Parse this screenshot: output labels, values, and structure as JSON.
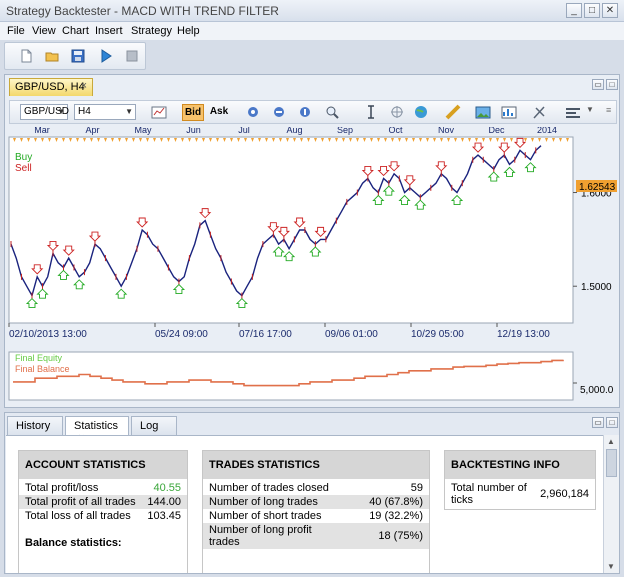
{
  "window": {
    "title": "Strategy Backtester - MACD WITH TREND FILTER"
  },
  "menu": [
    "File",
    "View",
    "Chart",
    "Insert",
    "Strategy",
    "Help"
  ],
  "toolbar": {
    "icons": [
      "new-file-icon",
      "open-folder-icon",
      "save-icon",
      "play-icon",
      "stop-icon"
    ]
  },
  "chart_tab": {
    "label": "GBP/USD, H4",
    "close": "×"
  },
  "chart_toolbar": {
    "symbol": "GBP/USD",
    "timeframe": "H4",
    "bid_label": "Bid",
    "ask_label": "Ask"
  },
  "colors": {
    "accent": "#f0a030",
    "buy": "#22aa22",
    "sell": "#cc2222",
    "equity": "#66cc44",
    "balance": "#e0704a",
    "bid_active": "#f7c26b"
  },
  "chart_data": {
    "type": "line",
    "title": "",
    "months": [
      "Mar",
      "Apr",
      "May",
      "Jun",
      "Jul",
      "Aug",
      "Sep",
      "Oct",
      "Nov",
      "Dec",
      "2014"
    ],
    "date_labels": [
      "02/10/2013 13:00",
      "05/24 09:00",
      "07/16 17:00",
      "09/06 01:00",
      "10/29 05:00",
      "12/19 13:00"
    ],
    "legend": [
      "Buy",
      "Sell"
    ],
    "y_ticks": [
      "1.6000",
      "1.5000"
    ],
    "last_price": "1.62543",
    "ylim": [
      1.465,
      1.655
    ],
    "series": [
      {
        "name": "Price",
        "values": [
          1.545,
          1.53,
          1.51,
          1.5,
          1.49,
          1.51,
          1.5,
          1.51,
          1.535,
          1.525,
          1.52,
          1.53,
          1.52,
          1.51,
          1.515,
          1.525,
          1.545,
          1.54,
          1.53,
          1.52,
          1.51,
          1.5,
          1.51,
          1.525,
          1.54,
          1.56,
          1.555,
          1.545,
          1.54,
          1.53,
          1.52,
          1.51,
          1.505,
          1.51,
          1.53,
          1.545,
          1.565,
          1.57,
          1.555,
          1.54,
          1.53,
          1.515,
          1.505,
          1.495,
          1.49,
          1.5,
          1.51,
          1.53,
          1.545,
          1.55,
          1.555,
          1.545,
          1.55,
          1.54,
          1.55,
          1.56,
          1.56,
          1.55,
          1.545,
          1.55,
          1.55,
          1.56,
          1.57,
          1.58,
          1.59,
          1.595,
          1.6,
          1.61,
          1.615,
          1.605,
          1.6,
          1.615,
          1.61,
          1.62,
          1.615,
          1.6,
          1.605,
          1.6,
          1.595,
          1.6,
          1.605,
          1.61,
          1.62,
          1.615,
          1.605,
          1.6,
          1.61,
          1.62,
          1.635,
          1.64,
          1.635,
          1.63,
          1.625,
          1.635,
          1.64,
          1.63,
          1.635,
          1.645,
          1.64,
          1.635,
          1.645,
          1.65
        ]
      }
    ],
    "lower_legend": [
      "Final Equity",
      "Final Balance"
    ],
    "lower_tick": "5,000.0",
    "lower_series": [
      {
        "name": "Final Balance",
        "values": [
          0.3,
          0.3,
          0.4,
          0.4,
          0.45,
          0.45,
          0.5,
          0.45,
          0.4,
          0.35,
          0.3,
          0.3,
          0.25,
          0.25,
          0.3,
          0.3,
          0.35,
          0.35,
          0.3,
          0.3,
          0.25,
          0.2,
          0.2,
          0.2,
          0.2,
          0.2,
          0.25,
          0.3,
          0.3,
          0.35,
          0.35,
          0.4,
          0.45,
          0.45,
          0.5,
          0.55,
          0.6,
          0.6,
          0.65,
          0.65,
          0.7,
          0.72,
          0.72,
          0.75,
          0.78,
          0.8,
          0.82,
          0.82,
          0.85,
          0.88,
          0.9
        ]
      }
    ]
  },
  "bottom_tabs": [
    {
      "label": "History"
    },
    {
      "label": "Statistics",
      "close": "×"
    },
    {
      "label": "Log"
    }
  ],
  "account_stats": {
    "header": "ACCOUNT STATISTICS",
    "rows": [
      {
        "label": "Total profit/loss",
        "value": "40.55"
      },
      {
        "label": "Total profit of all trades",
        "value": "144.00"
      },
      {
        "label": "Total loss of all trades",
        "value": "103.45"
      }
    ],
    "balance_label": "Balance statistics:"
  },
  "trades_stats": {
    "header": "TRADES STATISTICS",
    "rows": [
      {
        "label": "Number of trades closed",
        "value": "59"
      },
      {
        "label": "Number of long trades",
        "value": "40 (67.8%)"
      },
      {
        "label": "Number of short trades",
        "value": "19 (32.2%)"
      },
      {
        "label": "Number of long profit trades",
        "value": "18 (75%)"
      }
    ]
  },
  "backtesting_info": {
    "header": "BACKTESTING INFO",
    "rows": [
      {
        "label": "Total number of ticks",
        "value": "2,960,184"
      }
    ]
  }
}
